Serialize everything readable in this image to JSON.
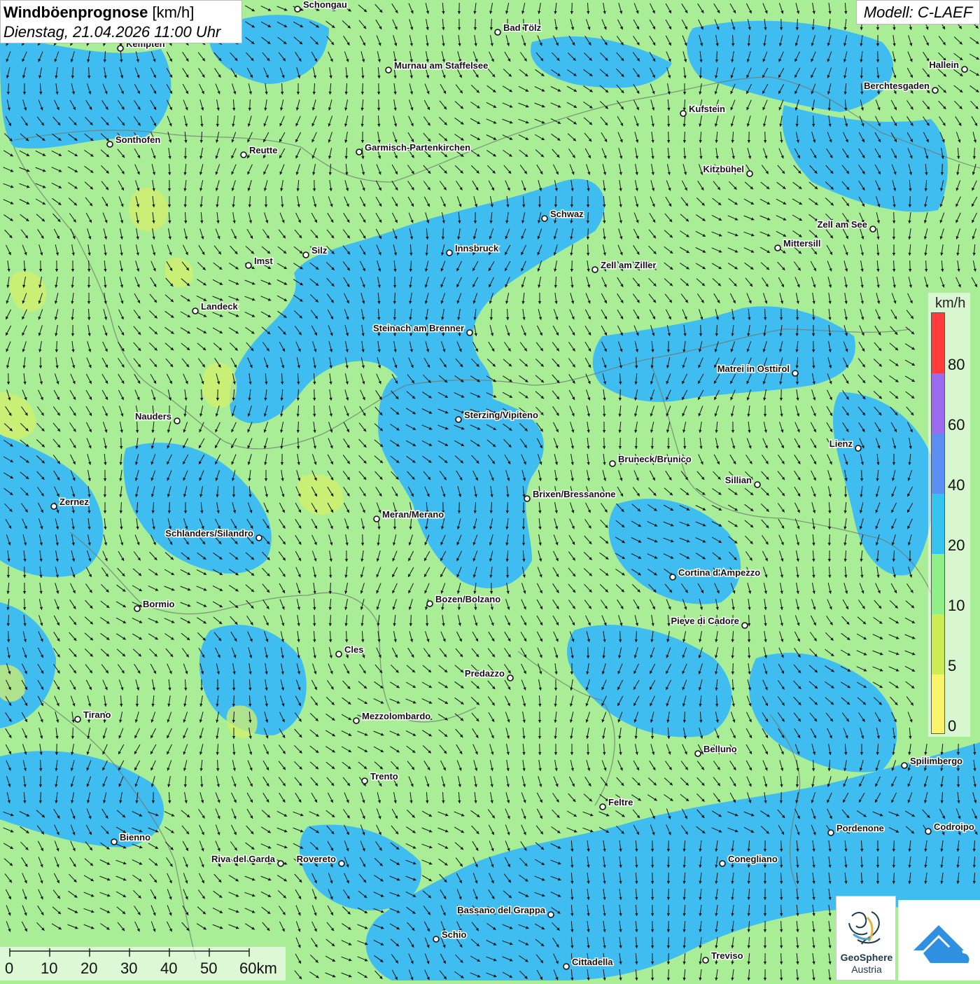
{
  "title": {
    "main": "Windböenprognose",
    "unit": "[km/h]",
    "datetime": "Dienstag, 21.04.2026 11:00 Uhr"
  },
  "model": "Modell: C-LAEF",
  "legend": {
    "unit": "km/h",
    "ticks": [
      "80",
      "60",
      "40",
      "20",
      "10",
      "5",
      "0"
    ],
    "colors": [
      "#ff3b3b",
      "#9b6bf0",
      "#5b8ef2",
      "#35c3f0",
      "#8ff08a",
      "#cdeb52",
      "#fbf46a"
    ]
  },
  "scale_bar": {
    "labels": [
      "0",
      "10",
      "20",
      "30",
      "40",
      "50",
      "60km"
    ]
  },
  "logos": {
    "geosphere_line1": "GeoSphere",
    "geosphere_line2": "Austria"
  },
  "colors": {
    "calm": "#a9ee97",
    "moderate": "#3fbdf1",
    "light": "#d6ef6a",
    "arrow": "#111111"
  },
  "cities": [
    {
      "name": "Schongau",
      "side": "r"
    },
    {
      "name": "Bad Tölz",
      "side": "r"
    },
    {
      "name": "Kempten",
      "side": "r"
    },
    {
      "name": "Murnau am Staffelsee",
      "side": "r"
    },
    {
      "name": "Hallein",
      "side": "l"
    },
    {
      "name": "Berchtesgaden",
      "side": "l"
    },
    {
      "name": "Kufstein",
      "side": "r"
    },
    {
      "name": "Sonthofen",
      "side": "r"
    },
    {
      "name": "Reutte",
      "side": "r"
    },
    {
      "name": "Garmisch-Partenkirchen",
      "side": "r"
    },
    {
      "name": "Kitzbühel",
      "side": "l"
    },
    {
      "name": "Schwaz",
      "side": "r"
    },
    {
      "name": "Zell am See",
      "side": "l"
    },
    {
      "name": "Innsbruck",
      "side": "r"
    },
    {
      "name": "Silz",
      "side": "r"
    },
    {
      "name": "Mittersill",
      "side": "r"
    },
    {
      "name": "Imst",
      "side": "r"
    },
    {
      "name": "Zell am Ziller",
      "side": "r"
    },
    {
      "name": "Landeck",
      "side": "r"
    },
    {
      "name": "Steinach am Brenner",
      "side": "l"
    },
    {
      "name": "Matrei in Osttirol",
      "side": "l"
    },
    {
      "name": "Nauders",
      "side": "l"
    },
    {
      "name": "Sterzing/Vipiteno",
      "side": "r"
    },
    {
      "name": "Lienz",
      "side": "l"
    },
    {
      "name": "Bruneck/Brunico",
      "side": "r"
    },
    {
      "name": "Sillian",
      "side": "l"
    },
    {
      "name": "Brixen/Bressanone",
      "side": "r"
    },
    {
      "name": "Zernez",
      "side": "r"
    },
    {
      "name": "Meran/Merano",
      "side": "r"
    },
    {
      "name": "Schlanders/Silandro",
      "side": "l"
    },
    {
      "name": "Cortina d'Ampezzo",
      "side": "r"
    },
    {
      "name": "Bozen/Bolzano",
      "side": "r"
    },
    {
      "name": "Bormio",
      "side": "r"
    },
    {
      "name": "Pieve di Cadore",
      "side": "l"
    },
    {
      "name": "Cles",
      "side": "r"
    },
    {
      "name": "Predazzo",
      "side": "l"
    },
    {
      "name": "Tirano",
      "side": "r"
    },
    {
      "name": "Mezzolombardo",
      "side": "r"
    },
    {
      "name": "Belluno",
      "side": "r"
    },
    {
      "name": "Spilimbergo",
      "side": "r"
    },
    {
      "name": "Trento",
      "side": "r"
    },
    {
      "name": "Feltre",
      "side": "r"
    },
    {
      "name": "Pordenone",
      "side": "r"
    },
    {
      "name": "Codroipo",
      "side": "r"
    },
    {
      "name": "Bienno",
      "side": "r"
    },
    {
      "name": "Riva del Garda",
      "side": "l"
    },
    {
      "name": "Rovereto",
      "side": "l"
    },
    {
      "name": "Conegliano",
      "side": "r"
    },
    {
      "name": "Bassano del Grappa",
      "side": "l"
    },
    {
      "name": "Schio",
      "side": "r"
    },
    {
      "name": "Treviso",
      "side": "r"
    },
    {
      "name": "Cittadella",
      "side": "r"
    }
  ]
}
